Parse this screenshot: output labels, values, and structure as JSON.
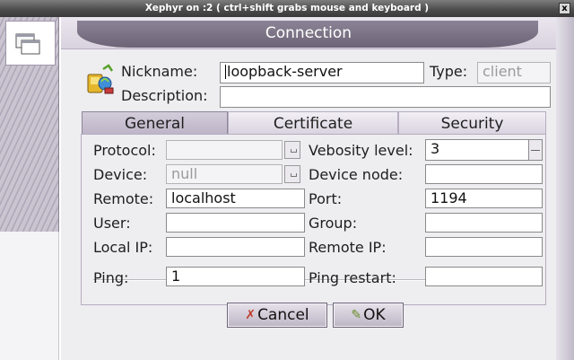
{
  "host": {
    "title": "Xephyr on :2 ( ctrl+shift grabs mouse and keyboard )",
    "close_glyph": "x"
  },
  "dialog": {
    "title": "Connection",
    "nickname_label": "Nickname:",
    "nickname_value": "loopback-server",
    "type_label": "Type:",
    "type_value": "client",
    "description_label": "Description:",
    "description_value": ""
  },
  "tabs": [
    {
      "label": "General",
      "active": true
    },
    {
      "label": "Certificate",
      "active": false
    },
    {
      "label": "Security",
      "active": false
    }
  ],
  "general": {
    "protocol_label": "Protocol:",
    "protocol_value": "",
    "verbosity_label": "Vebosity level:",
    "verbosity_value": "3",
    "device_label": "Device:",
    "device_value": "null",
    "device_node_label": "Device node:",
    "device_node_value": "",
    "remote_label": "Remote:",
    "remote_value": "localhost",
    "port_label": "Port:",
    "port_value": "1194",
    "user_label": "User:",
    "user_value": "",
    "group_label": "Group:",
    "group_value": "",
    "local_ip_label": "Local IP:",
    "local_ip_value": "",
    "remote_ip_label": "Remote IP:",
    "remote_ip_value": "",
    "ping_label": "Ping:",
    "ping_value": "1",
    "ping_restart_label": "Ping restart:",
    "ping_restart_value": ""
  },
  "buttons": {
    "cancel_label": "Cancel",
    "ok_label": "OK"
  },
  "colors": {
    "title_band": "#7a7284",
    "dialog_bg": "#eeedf0",
    "button_border": "#6e6678"
  }
}
